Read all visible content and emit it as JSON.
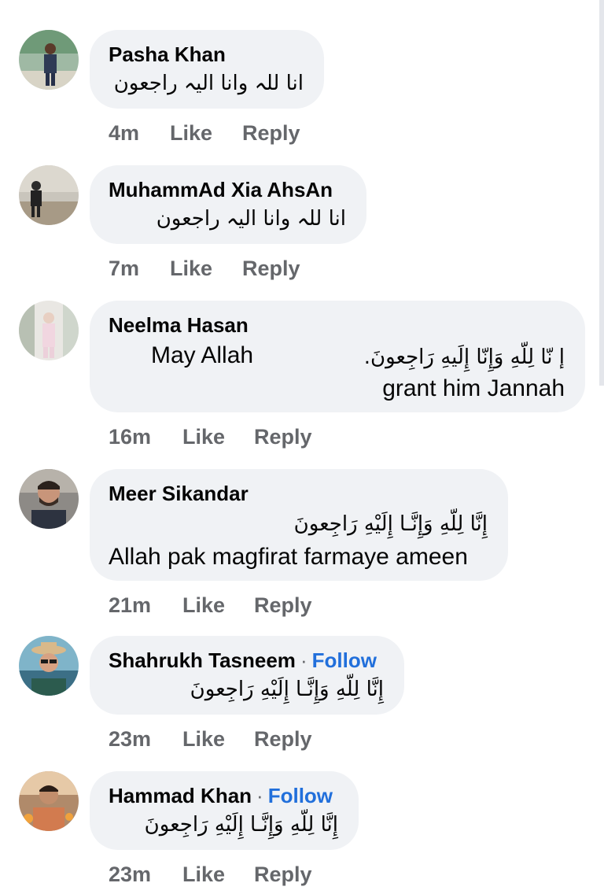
{
  "comments": [
    {
      "name": "Pasha Khan",
      "text": "انا للہ وانا الیہ راجعون",
      "time": "4m",
      "like": "Like",
      "reply": "Reply"
    },
    {
      "name": "MuhammAd Xia AhsAn",
      "text": "انا للہ وانا الیہ راجعون",
      "time": "7m",
      "like": "Like",
      "reply": "Reply"
    },
    {
      "name": "Neelma Hasan",
      "text_left": "May Allah",
      "text_arabic": "إ نّا لِلّهِ وَإِنّا إِلَيهِ رَاجِعونَ.",
      "text_line2": "grant him  Jannah",
      "time": "16m",
      "like": "Like",
      "reply": "Reply"
    },
    {
      "name": "Meer Sikandar",
      "text_arabic": "إِنَّا لِلّهِ وَإِنَّـا إِلَيْهِ رَاجِعونَ",
      "text_line2": "Allah pak magfirat farmaye ameen",
      "time": "21m",
      "like": "Like",
      "reply": "Reply"
    },
    {
      "name": "Shahrukh Tasneem",
      "separator": "·",
      "follow": "Follow",
      "text": "إِنَّا لِلّهِ وَإِنَّـا إِلَيْهِ رَاجِعونَ",
      "time": "23m",
      "like": "Like",
      "reply": "Reply"
    },
    {
      "name": "Hammad Khan",
      "separator": "·",
      "follow": "Follow",
      "text": "إِنَّا لِلّهِ وَإِنَّـا إِلَيْهِ رَاجِعونَ",
      "time": "23m",
      "like": "Like",
      "reply": "Reply"
    }
  ],
  "colors": {
    "bubble": "#f0f2f5",
    "secondary_text": "#65676b",
    "follow": "#216fdb"
  }
}
